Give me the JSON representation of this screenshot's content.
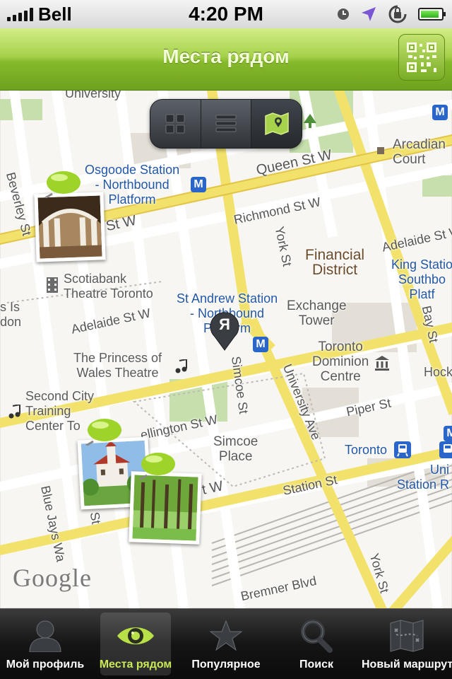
{
  "status_bar": {
    "carrier": "Bell",
    "time": "4:20 PM",
    "icons": [
      "signal-icon",
      "clock-icon",
      "location-arrow-icon",
      "rotation-lock-icon",
      "battery-icon"
    ],
    "battery_level": 0.9
  },
  "nav": {
    "title": "Места рядом",
    "qr_icon": "qr-code-icon",
    "accent": "#8dbd30"
  },
  "view_switcher": {
    "options": [
      "grid-view-icon",
      "list-view-icon",
      "map-view-icon"
    ],
    "selected": "map-view-icon"
  },
  "map": {
    "labels": {
      "university": "University",
      "osgoode": "Osgoode Station\n- Northbound\nPlatform",
      "queen": "Queen St W",
      "arcadian": "Arcadian\nCourt",
      "beverley": "Beverley St",
      "stw": "St W",
      "richmond": "Richmond St W",
      "york_top": "York St",
      "adelaide_e": "Adelaide St W",
      "financial": "Financial\nDistrict",
      "king": "King Statio\nSouthbo\nPlatf",
      "scotiabank": "Scotiabank\nTheatre Toronto",
      "left_cut": "s Is\ndon",
      "st_andrew": "St Andrew Station\n- Northbound\nPlatform",
      "exchange": "Exchange\nTower",
      "adelaide_w": "Adelaide St W",
      "bay": "Bay St",
      "princess": "The Princess of\nWales Theatre",
      "toronto_dominion": "Toronto\nDominion\nCentre",
      "hock": "Hock",
      "simcoe_st": "Simcoe St",
      "university_ave": "University Ave",
      "second_city": "Second City\nTraining\nCenter To",
      "piper": "Piper St",
      "wellington": "ellington St W",
      "simcoe_place": "Simcoe\nPlace",
      "toronto": "Toronto",
      "union": "Uni\nStation R",
      "blue_jays": "Blue Jays Wa",
      "st_left": "St",
      "st_w_bottom": "t W",
      "station_st": "Station St",
      "york_bottom": "York St",
      "bremner": "Bremner Blvd",
      "google": "Google"
    },
    "me_marker_letter": "Я"
  },
  "tabs": [
    {
      "label": "Мой профиль",
      "icon": "profile-icon"
    },
    {
      "label": "Места рядом",
      "icon": "eye-icon"
    },
    {
      "label": "Популярное",
      "icon": "star-icon"
    },
    {
      "label": "Поиск",
      "icon": "search-icon"
    },
    {
      "label": "Новый маршрут",
      "icon": "route-map-icon"
    }
  ],
  "active_tab": "Места рядом"
}
